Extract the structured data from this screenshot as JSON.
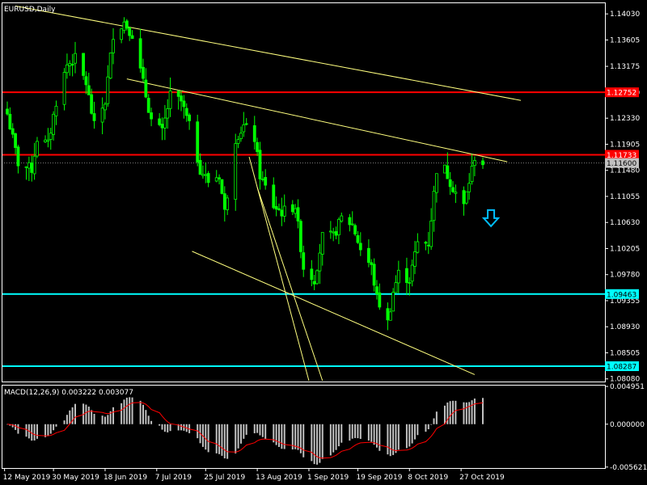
{
  "chart_title": "EURUSD,Daily",
  "colors": {
    "background": "#000000",
    "frame": "#ffffff",
    "candle": "#00ff00",
    "resistance": "#ff0000",
    "support": "#00ffff",
    "trendline": "#ffff7f",
    "macd_histogram": "#c0c0c0",
    "macd_signal": "#ff0000",
    "arrow": "#00bfff"
  },
  "main_panel": {
    "price_min": 1.08037,
    "price_max": 1.14217,
    "price_ticks": [
      "1.14030",
      "1.13605",
      "1.13175",
      "1.12750",
      "1.12330",
      "1.11905",
      "1.11480",
      "1.11055",
      "1.10630",
      "1.10205",
      "1.09780",
      "1.09355",
      "1.08930",
      "1.08505",
      "1.08080"
    ],
    "current_price_label": "1.11600",
    "current_price": 1.116
  },
  "levels": [
    {
      "name": "resistance-upper",
      "price": 1.12752,
      "label": "1.12752",
      "color": "#ff0000"
    },
    {
      "name": "resistance-lower",
      "price": 1.11733,
      "label": "1.11733",
      "color": "#ff0000"
    },
    {
      "name": "support-upper",
      "price": 1.09463,
      "label": "1.09463",
      "color": "#00ffff"
    },
    {
      "name": "support-lower",
      "price": 1.08287,
      "label": "1.08287",
      "color": "#00ffff"
    }
  ],
  "trendlines": [
    {
      "name": "trendline-long-upper",
      "from": [
        "2019-05-16",
        1.1416
      ],
      "to": [
        "2019-11-18",
        1.1262
      ]
    },
    {
      "name": "trendline-short-upper",
      "from": [
        "2019-06-26",
        1.1297
      ],
      "to": [
        "2019-11-13",
        1.1162
      ]
    },
    {
      "name": "trendline-lower-channel",
      "from": [
        "2019-07-20",
        1.1016
      ],
      "to": [
        "2019-11-01",
        1.0815
      ]
    },
    {
      "name": "trendline-steep-1",
      "from": [
        "2019-08-10",
        1.117
      ],
      "to": [
        "2019-09-01",
        1.0805
      ]
    },
    {
      "name": "trendline-steep-2",
      "from": [
        "2019-08-13",
        1.112
      ],
      "to": [
        "2019-09-06",
        1.0805
      ]
    }
  ],
  "arrow": {
    "name": "down-arrow-icon",
    "date": "2019-11-07",
    "price": 1.107
  },
  "macd": {
    "title": "MACD(12,26,9) 0.003222 0.003077",
    "min": -0.00575,
    "max": 0.00517,
    "ticks": [
      "0.004951",
      "0.000000",
      "-0.005621"
    ],
    "tick_values": [
      0.004951,
      0.0,
      -0.005621
    ]
  },
  "x_axis_ticks": [
    "12 May 2019",
    "30 May 2019",
    "18 Jun 2019",
    "7 Jul 2019",
    "25 Jul 2019",
    "13 Aug 2019",
    "1 Sep 2019",
    "19 Sep 2019",
    "8 Oct 2019",
    "27 Oct 2019"
  ],
  "x_axis_dates": [
    "2019-05-12",
    "2019-05-30",
    "2019-06-18",
    "2019-07-07",
    "2019-07-25",
    "2019-08-13",
    "2019-09-01",
    "2019-09-19",
    "2019-10-08",
    "2019-10-27"
  ],
  "chart_data": {
    "type": "candlestick",
    "title": "EURUSD,Daily",
    "x_start": "2019-05-13",
    "x_end": "2019-11-04",
    "ylim": [
      1.08037,
      1.14217
    ],
    "series": [
      {
        "name": "EURUSD",
        "close_anchors": [
          [
            "2019-05-13",
            1.124
          ],
          [
            "2019-05-17",
            1.116
          ],
          [
            "2019-05-22",
            1.115
          ],
          [
            "2019-05-24",
            1.12
          ],
          [
            "2019-05-28",
            1.119
          ],
          [
            "2019-05-31",
            1.126
          ],
          [
            "2019-06-04",
            1.132
          ],
          [
            "2019-06-07",
            1.133
          ],
          [
            "2019-06-11",
            1.129
          ],
          [
            "2019-06-14",
            1.122
          ],
          [
            "2019-06-18",
            1.126
          ],
          [
            "2019-06-21",
            1.137
          ],
          [
            "2019-06-25",
            1.139
          ],
          [
            "2019-06-28",
            1.137
          ],
          [
            "2019-07-02",
            1.129
          ],
          [
            "2019-07-05",
            1.123
          ],
          [
            "2019-07-09",
            1.121
          ],
          [
            "2019-07-12",
            1.127
          ],
          [
            "2019-07-16",
            1.126
          ],
          [
            "2019-07-19",
            1.122
          ],
          [
            "2019-07-23",
            1.115
          ],
          [
            "2019-07-26",
            1.113
          ],
          [
            "2019-07-30",
            1.114
          ],
          [
            "2019-08-01",
            1.108
          ],
          [
            "2019-08-05",
            1.12
          ],
          [
            "2019-08-08",
            1.122
          ],
          [
            "2019-08-12",
            1.12
          ],
          [
            "2019-08-14",
            1.114
          ],
          [
            "2019-08-19",
            1.109
          ],
          [
            "2019-08-22",
            1.108
          ],
          [
            "2019-08-27",
            1.109
          ],
          [
            "2019-08-30",
            1.099
          ],
          [
            "2019-09-03",
            1.097
          ],
          [
            "2019-09-06",
            1.104
          ],
          [
            "2019-09-10",
            1.104
          ],
          [
            "2019-09-13",
            1.107
          ],
          [
            "2019-09-17",
            1.106
          ],
          [
            "2019-09-20",
            1.102
          ],
          [
            "2019-09-24",
            1.099
          ],
          [
            "2019-09-26",
            1.094
          ],
          [
            "2019-09-30",
            1.09
          ],
          [
            "2019-10-02",
            1.095
          ],
          [
            "2019-10-04",
            1.098
          ],
          [
            "2019-10-08",
            1.097
          ],
          [
            "2019-10-11",
            1.103
          ],
          [
            "2019-10-15",
            1.103
          ],
          [
            "2019-10-18",
            1.115
          ],
          [
            "2019-10-21",
            1.115
          ],
          [
            "2019-10-24",
            1.112
          ],
          [
            "2019-10-28",
            1.109
          ],
          [
            "2019-10-30",
            1.113
          ],
          [
            "2019-11-01",
            1.117
          ],
          [
            "2019-11-04",
            1.116
          ]
        ]
      }
    ]
  }
}
